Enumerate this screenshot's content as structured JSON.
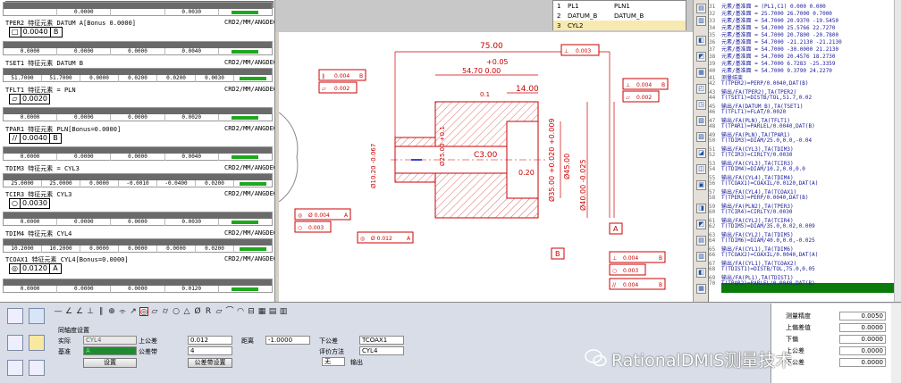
{
  "report": {
    "blocks": [
      {
        "head": "TPER2",
        "ftype": "特征元素",
        "datum": "DATUM A[Bonus 0.0000]",
        "right": "CRD2/MM/ANGDEC",
        "fcf": [
          "□",
          "0.0040",
          "B"
        ]
      },
      {
        "head": "TSET1",
        "ftype": "特征元素",
        "datum": "DATUM B",
        "right": "CRD2/MM/ANGDEC",
        "row": [
          "51.7000",
          "51.7000",
          "0.0000",
          "0.0200",
          "0.0200",
          "0.0030"
        ]
      },
      {
        "head": "TFLT1",
        "ftype": "特征元素",
        "datum": "= PLN",
        "right": "CRD2/MM/ANGDEC",
        "fcf": [
          "▱",
          "0.0020"
        ]
      },
      {
        "head": "TPAR1",
        "ftype": "特征元素",
        "datum": "PLN[Bonus=0.0000]",
        "right": "CRD2/MM/ANGDEC",
        "fcf": [
          "//",
          "0.0040",
          "B"
        ]
      },
      {
        "head": "TDIM3",
        "ftype": "特征元素",
        "datum": "= CYL3",
        "right": "CRD2/MM/ANGDEC",
        "row": [
          "25.0000",
          "25.0000",
          "0.0000",
          "-0.0010",
          "-0.0400",
          "0.0200"
        ]
      },
      {
        "head": "TCIR3",
        "ftype": "特征元素",
        "datum": "CYL3",
        "right": "CRD2/MM/ANGDEC",
        "fcf": [
          "○",
          "0.0030"
        ]
      },
      {
        "head": "TDIM4",
        "ftype": "特征元素",
        "datum": "CYL4",
        "right": "CRD2/MM/ANGDEC",
        "row": [
          "10.2000",
          "10.2000",
          "0.0000",
          "0.0000",
          "0.0000",
          "0.0200"
        ]
      },
      {
        "head": "TCOAX1",
        "ftype": "特征元素",
        "datum": "CYL4[Bonus=0.0000]",
        "right": "CRD2/MM/ANGDEC",
        "fcf": [
          "◎",
          "0.0120",
          "A"
        ]
      }
    ],
    "rows_extra": [
      [
        "0.0000",
        "0.0000",
        "0.0000",
        "0.0020"
      ],
      [
        "0.0000",
        "0.0000",
        "0.0000",
        "0.0040"
      ],
      [
        "0.0000",
        "0.0000",
        "0.0000",
        "0.0030"
      ],
      [
        "0.0000",
        "0.0000",
        "0.0000",
        "0.0120"
      ]
    ]
  },
  "features": [
    {
      "num": "1",
      "name": "PL1",
      "type": "PLN1"
    },
    {
      "num": "2",
      "name": "DATUM_B",
      "type": "DATUM_B"
    },
    {
      "num": "3",
      "name": "CYL2",
      "type": ""
    }
  ],
  "drawing": {
    "dims": [
      "75.00",
      "+0.05",
      "54.70   0.00",
      "14.00",
      "0.1",
      "C3.00",
      "0.20",
      "Ø35.00 +0.020 +0.009",
      "Ø40.00 -0.025",
      "Ø10.20 -0.067",
      "Ø45.00",
      "Ø25.00 +0.1",
      "B",
      "A",
      "A"
    ],
    "fcfs": [
      {
        "sym": "∥",
        "tol": "0.004",
        "d": "B"
      },
      {
        "sym": "▱",
        "tol": "0.002"
      },
      {
        "sym": "⊥",
        "tol": "0.003"
      },
      {
        "sym": "⊥",
        "tol": "0.004",
        "d": "B"
      },
      {
        "sym": "▱",
        "tol": "0.002"
      },
      {
        "sym": "◎",
        "tol": "Ø 0.004",
        "d": "A"
      },
      {
        "sym": "○",
        "tol": "0.003"
      },
      {
        "sym": "◎",
        "tol": "Ø 0.012",
        "d": "A"
      },
      {
        "sym": "⊥",
        "tol": "0.004",
        "d": "B"
      },
      {
        "sym": "○",
        "tol": "0.003"
      },
      {
        "sym": "//",
        "tol": "0.004",
        "d": "B"
      }
    ]
  },
  "code_lines": [
    {
      "n": "31",
      "t": "元素/基准面 = (PL1,C1) 0.000 0.000"
    },
    {
      "n": "32",
      "t": "元素/基准面 = 25.7000 26.7000 0.7000"
    },
    {
      "n": "33",
      "t": "元素/基准面 = 54.7000 20.9370 -19.5450"
    },
    {
      "n": "34",
      "t": "元素/基准面 = 54.7000 25.5766 22.7270"
    },
    {
      "n": "35",
      "t": "元素/基准面 = 54.7000 20.7800 -20.7800"
    },
    {
      "n": "36",
      "t": "元素/基准面 = 54.7000 -21.2130 -21.2130"
    },
    {
      "n": "37",
      "t": "元素/基准面 = 54.7000 -30.0000 21.2130"
    },
    {
      "n": "38",
      "t": "元素/基准面 = 54.7000 20.4576 18.2730"
    },
    {
      "n": "39",
      "t": "元素/基准面 = 54.7000 6.7283 -25.3359"
    },
    {
      "n": "40",
      "t": "元素/基准面 = 54.7000 9.3790 24.2270"
    },
    {
      "n": "41",
      "t": "测量结束"
    },
    {
      "n": "42",
      "t": "T(TPER2)=PERP/0.0040,DAT(B)"
    },
    {
      "n": "43",
      "t": "输出/FA(TPER2),TA(TPER2)"
    },
    {
      "n": "44",
      "t": "T(TSET1)=DISTB/TOL,51.7,0.02"
    },
    {
      "n": "45",
      "t": "输出/FA(DATUM_B),TA(TSET1)"
    },
    {
      "n": "46",
      "t": "T(TFLT1)=FLAT/0.0020"
    },
    {
      "n": "47",
      "t": "输出/FA(PLN),TA(TFLT1)"
    },
    {
      "n": "48",
      "t": "T(TPAR1)=PARLEL/0.0040,DAT(B)"
    },
    {
      "n": "49",
      "t": "输出/FA(PLN),TA(TPAR1)"
    },
    {
      "n": "50",
      "t": "T(TDIM3)=DIAM/25.0,0.0,-0.04"
    },
    {
      "n": "51",
      "t": "输出/FA(CYL3),TA(TDIM3)"
    },
    {
      "n": "52",
      "t": "T(TCIR3)=CIRLTY/0.0030"
    },
    {
      "n": "53",
      "t": "输出/FA(CYL3),TA(TCIR3)"
    },
    {
      "n": "54",
      "t": "T(TDIM4)=DIAM/10.2,0.0,0.0"
    },
    {
      "n": "55",
      "t": "输出/FA(CYL4),TA(TDIM4)"
    },
    {
      "n": "56",
      "t": "T(TCOAX1)=COAXIL/0.0120,DAT(A)"
    },
    {
      "n": "57",
      "t": "输出/FA(CYL4),TA(TCOAX1)"
    },
    {
      "n": "58",
      "t": "T(TPER3)=PERP/0.0040,DAT(B)"
    },
    {
      "n": "59",
      "t": "输出/FA(PLN2),TA(TPER3)"
    },
    {
      "n": "60",
      "t": "T(TCIR4)=CIRLTY/0.0030"
    },
    {
      "n": "61",
      "t": "输出/FA(CYL2),TA(TCIR4)"
    },
    {
      "n": "62",
      "t": "T(TDIM5)=DIAM/35.0,0.02,0.009"
    },
    {
      "n": "63",
      "t": "输出/FA(CYL2),TA(TDIM5)"
    },
    {
      "n": "64",
      "t": "T(TDIM6)=DIAM/40.0,0.0,-0.025"
    },
    {
      "n": "65",
      "t": "输出/FA(CYL1),TA(TDIM6)"
    },
    {
      "n": "66",
      "t": "T(TCOAX2)=COAXIL/0.0040,DAT(A)"
    },
    {
      "n": "67",
      "t": "输出/FA(CYL1),TA(TCOAX2)"
    },
    {
      "n": "68",
      "t": "T(TDIST1)=DISTB/TOL,75.0,0.05"
    },
    {
      "n": "69",
      "t": "输出/FA(PL1),TA(TDIST1)"
    },
    {
      "n": "70",
      "t": "T(TPAR2)=PARLEL/0.0040,DAT(B)"
    }
  ],
  "bottom": {
    "gt_title": "同轴度设置",
    "labels": {
      "actual": "实际",
      "datum": "基准",
      "eval": "评价方法",
      "tol_zone": "公差带",
      "dist": "距离",
      "upper": "上公差",
      "lower": "下公差",
      "out_mode": "输出"
    },
    "values": {
      "actual": "CYL4",
      "datum": "A",
      "v1": "0.012",
      "v2": "4",
      "dist": "-1.0000",
      "ref": "TCOAX1",
      "ref2": "CYL4"
    },
    "buttons": {
      "b1": "设置",
      "b2": "公差带设置"
    },
    "select": "无"
  },
  "rightpanel": {
    "rows": [
      {
        "l": "测量精度",
        "v": "0.0050"
      },
      {
        "l": "上偏差值",
        "v": "0.0000"
      },
      {
        "l": "下偏",
        "v": "0.0000"
      },
      {
        "l": "上公差",
        "v": "0.0000"
      },
      {
        "l": "下公差",
        "v": "0.0000"
      }
    ]
  },
  "watermark": "RationalDMIS测量技术"
}
